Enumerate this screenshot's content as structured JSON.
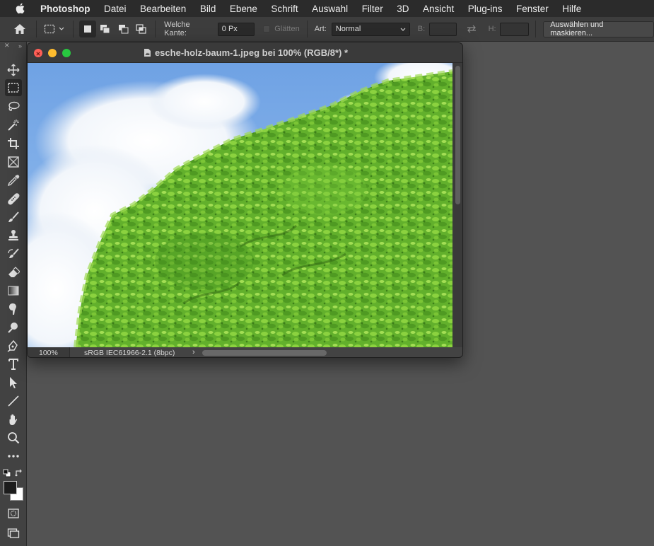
{
  "menubar": {
    "app_name": "Photoshop",
    "items": [
      "Datei",
      "Bearbeiten",
      "Bild",
      "Ebene",
      "Schrift",
      "Auswahl",
      "Filter",
      "3D",
      "Ansicht",
      "Plug-ins",
      "Fenster",
      "Hilfe"
    ]
  },
  "options_bar": {
    "feather_label": "Welche Kante:",
    "feather_value": "0 Px",
    "antialias_label": "Glätten",
    "style_label": "Art:",
    "style_value": "Normal",
    "width_label": "B:",
    "height_label": "H:",
    "select_mask_button": "Auswählen und maskieren..."
  },
  "document": {
    "title": "esche-holz-baum-1.jpeg bei 100% (RGB/8*) *",
    "zoom": "100%",
    "color_profile": "sRGB IEC61966-2.1 (8bpc)"
  },
  "colors": {
    "menubar_bg": "#2b2b2b",
    "workspace_bg": "#535353",
    "panel_bg": "#424242",
    "close": "#ff5f57",
    "minimize": "#febc2e",
    "zoom": "#28c840",
    "sky": "#7eaee8",
    "foliage": "#6ab82f"
  },
  "tools": [
    "move-tool-icon",
    "marquee-tool-icon",
    "lasso-tool-icon",
    "magic-wand-icon",
    "crop-tool-icon",
    "frame-tool-icon",
    "eyedropper-icon",
    "healing-brush-icon",
    "brush-tool-icon",
    "clone-stamp-icon",
    "history-brush-icon",
    "eraser-icon",
    "gradient-tool-icon",
    "smudge-tool-icon",
    "dodge-tool-icon",
    "pen-tool-icon",
    "type-tool-icon",
    "path-select-icon",
    "line-tool-icon",
    "hand-tool-icon",
    "zoom-tool-icon",
    "more-tools-icon"
  ]
}
